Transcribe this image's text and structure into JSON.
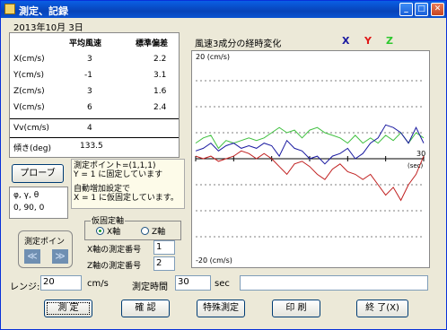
{
  "window": {
    "title": "測定、記録"
  },
  "date": "2013年10月 3日",
  "table": {
    "headers": [
      "平均風速",
      "標準偏差"
    ],
    "rows": [
      {
        "label": "X(cm/s)",
        "avg": "3",
        "std": "2.2"
      },
      {
        "label": "Y(cm/s)",
        "avg": "-1",
        "std": "3.1"
      },
      {
        "label": "Z(cm/s)",
        "avg": "3",
        "std": "1.6"
      },
      {
        "label": "V(cm/s)",
        "avg": "6",
        "std": "2.4"
      },
      {
        "label": "Vv(cm/s)",
        "avg": "4",
        "std": ""
      },
      {
        "label": "傾き(deg)",
        "avg": "133.5",
        "std": ""
      }
    ]
  },
  "probe_button": "プローブ",
  "angles": {
    "label": "φ, γ, θ",
    "value": "0, 90, 0"
  },
  "note": {
    "line1": "測定ポイント=(1,1,1)",
    "line2": "Y = 1 に固定しています",
    "line3": "自動増加設定で",
    "line4": "X = 1 に仮固定しています。"
  },
  "measure_point": {
    "label": "測定ポイント",
    "prev": "≪",
    "next": "≫"
  },
  "axis": {
    "legend": "仮固定軸",
    "x": "X軸",
    "z": "Z軸",
    "selected": "X軸"
  },
  "x_axis_no": {
    "label": "X軸の測定番号",
    "value": "1"
  },
  "z_axis_no": {
    "label": "Z軸の測定番号",
    "value": "2"
  },
  "range": {
    "label": "レンジ:",
    "value": "20",
    "unit": "cm/s"
  },
  "time": {
    "label": "測定時間",
    "value": "30",
    "unit": "sec"
  },
  "buttons": {
    "measure": "測 定",
    "confirm": "確 認",
    "special": "特殊測定",
    "print": "印 刷",
    "exit": "終 了(X)"
  },
  "chart_data": {
    "type": "line",
    "title": "風速3成分の経時変化",
    "ytop_label": "20 (cm/s)",
    "ybottom_label": "-20 (cm/s)",
    "x_end_label": "30",
    "x_unit_label": "(sec)",
    "xlim": [
      0,
      30
    ],
    "ylim": [
      -20,
      20
    ],
    "grid": true,
    "legend": "top-right",
    "series": [
      {
        "name": "X",
        "color": "#1a1aa0",
        "x": [
          0,
          1,
          2,
          3,
          4,
          5,
          6,
          7,
          8,
          9,
          10,
          11,
          12,
          13,
          14,
          15,
          16,
          17,
          18,
          19,
          20,
          21,
          22,
          23,
          24,
          25,
          26,
          27,
          28,
          29,
          30
        ],
        "values": [
          1.5,
          2,
          3,
          1.5,
          2.5,
          3,
          2,
          2.5,
          2,
          3,
          2.5,
          0.5,
          3.5,
          2,
          1.5,
          0,
          0.5,
          -1,
          0.5,
          1,
          2,
          0,
          1,
          3,
          4,
          6.5,
          6,
          5,
          3,
          6,
          3
        ]
      },
      {
        "name": "Y",
        "color": "#c02020",
        "x": [
          0,
          1,
          2,
          3,
          4,
          5,
          6,
          7,
          8,
          9,
          10,
          11,
          12,
          13,
          14,
          15,
          16,
          17,
          18,
          19,
          20,
          21,
          22,
          23,
          24,
          25,
          26,
          27,
          28,
          29,
          30
        ],
        "values": [
          0.5,
          0,
          0.5,
          -0.5,
          0,
          0.5,
          1.5,
          1,
          0,
          1,
          0,
          -1.5,
          -3,
          -1,
          -0.5,
          -1.5,
          -3,
          -4,
          -2,
          -1,
          -2.5,
          -3,
          -4,
          -3,
          -5,
          -7,
          -5.5,
          -8,
          -5,
          -3,
          0.5
        ]
      },
      {
        "name": "Z",
        "color": "#40c040",
        "x": [
          0,
          1,
          2,
          3,
          4,
          5,
          6,
          7,
          8,
          9,
          10,
          11,
          12,
          13,
          14,
          15,
          16,
          17,
          18,
          19,
          20,
          21,
          22,
          23,
          24,
          25,
          26,
          27,
          28,
          29,
          30
        ],
        "values": [
          3,
          4,
          4.5,
          2,
          3.5,
          3,
          3.5,
          4,
          3.5,
          4,
          5,
          6,
          5,
          5.5,
          4,
          5.5,
          6,
          5,
          4.5,
          4,
          3,
          4.5,
          3,
          4,
          3,
          4.5,
          3.5,
          5,
          3,
          5,
          4
        ]
      }
    ]
  }
}
